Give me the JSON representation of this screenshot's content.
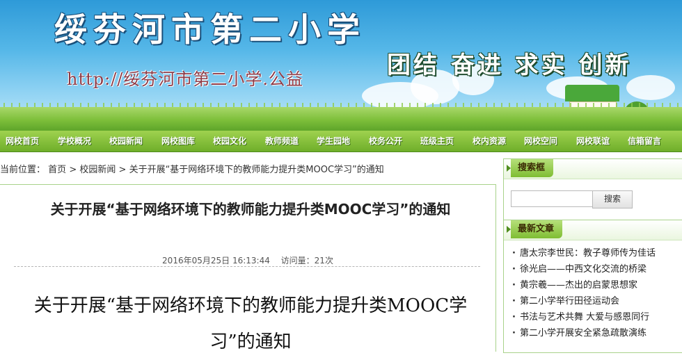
{
  "header": {
    "school_name": "绥芬河市第二小学",
    "url_text": "http://绥芬河市第二小学.公益",
    "motto": "团结 奋进 求实 创新"
  },
  "nav": {
    "items": [
      "网校首页",
      "学校概况",
      "校园新闻",
      "网校图库",
      "校园文化",
      "教师频道",
      "学生园地",
      "校务公开",
      "班级主页",
      "校内资源",
      "网校空间",
      "网校联谊",
      "信箱留言"
    ]
  },
  "breadcrumb": {
    "prefix": "当前位置：",
    "home": "首页",
    "sep": ">",
    "section": "校园新闻",
    "current": "关于开展“基于网络环境下的教师能力提升类MOOC学习”的通知"
  },
  "article": {
    "title": "关于开展“基于网络环境下的教师能力提升类MOOC学习”的通知",
    "date": "2016年05月25日 16:13:44",
    "views": "访问量：21次",
    "body_title": "关于开展“基于网络环境下的教师能力提升类MOOC学习”的通知"
  },
  "sidebar": {
    "search": {
      "heading": "搜索框",
      "placeholder": "",
      "button": "搜索"
    },
    "latest": {
      "heading": "最新文章",
      "items": [
        "唐太宗李世民：教子尊师传为佳话",
        "徐光启——中西文化交流的桥梁",
        "黄宗羲——杰出的启蒙思想家",
        "第二小学举行田径运动会",
        "书法与艺术共舞 大爱与感恩同行",
        "第二小学开展安全紧急疏散演练"
      ]
    }
  },
  "colors": {
    "nav_green": "#6fae2a",
    "sky_blue": "#2e9ad8",
    "border_green": "#a8d28a"
  }
}
